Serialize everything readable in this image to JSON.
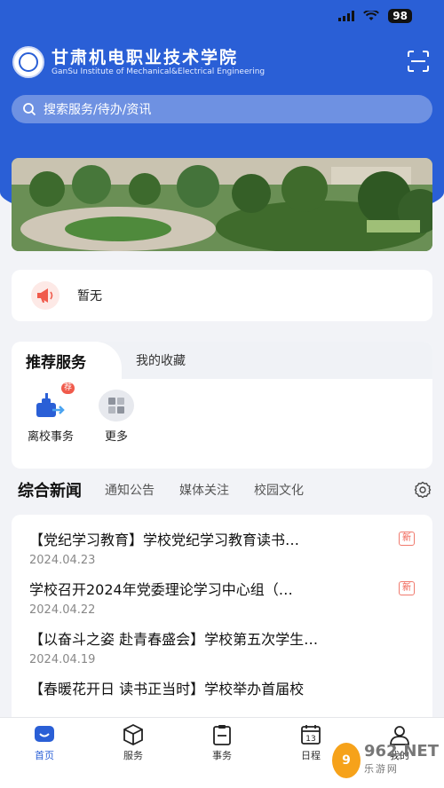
{
  "status_bar": {
    "battery": "98"
  },
  "school": {
    "name_cn": "甘肃机电职业技术学院",
    "name_en": "GanSu Institute of Mechanical&Electrical Engineering"
  },
  "search": {
    "placeholder": "搜索服务/待办/资讯"
  },
  "notice": {
    "text": "暂无"
  },
  "services": {
    "tabs": [
      "推荐服务",
      "我的收藏"
    ],
    "items": [
      {
        "label": "离校事务",
        "badge": "荐"
      },
      {
        "label": "更多"
      }
    ]
  },
  "news": {
    "tabs": [
      "综合新闻",
      "通知公告",
      "媒体关注",
      "校园文化"
    ],
    "new_tag": "新",
    "items": [
      {
        "title": "【党纪学习教育】学校党纪学习教育读书…",
        "date": "2024.04.23"
      },
      {
        "title": "学校召开2024年党委理论学习中心组（…",
        "date": "2024.04.22"
      },
      {
        "title": "【以奋斗之姿 赴青春盛会】学校第五次学生…",
        "date": "2024.04.19"
      },
      {
        "title": "【春暖花开日 读书正当时】学校举办首届校",
        "date": ""
      }
    ]
  },
  "tabbar": [
    "首页",
    "服务",
    "事务",
    "日程",
    "我的"
  ],
  "watermark": {
    "brand": "962.NET",
    "sub": "乐游网"
  },
  "colors": {
    "primary": "#2a5fd6",
    "badge": "#f05a4b"
  }
}
